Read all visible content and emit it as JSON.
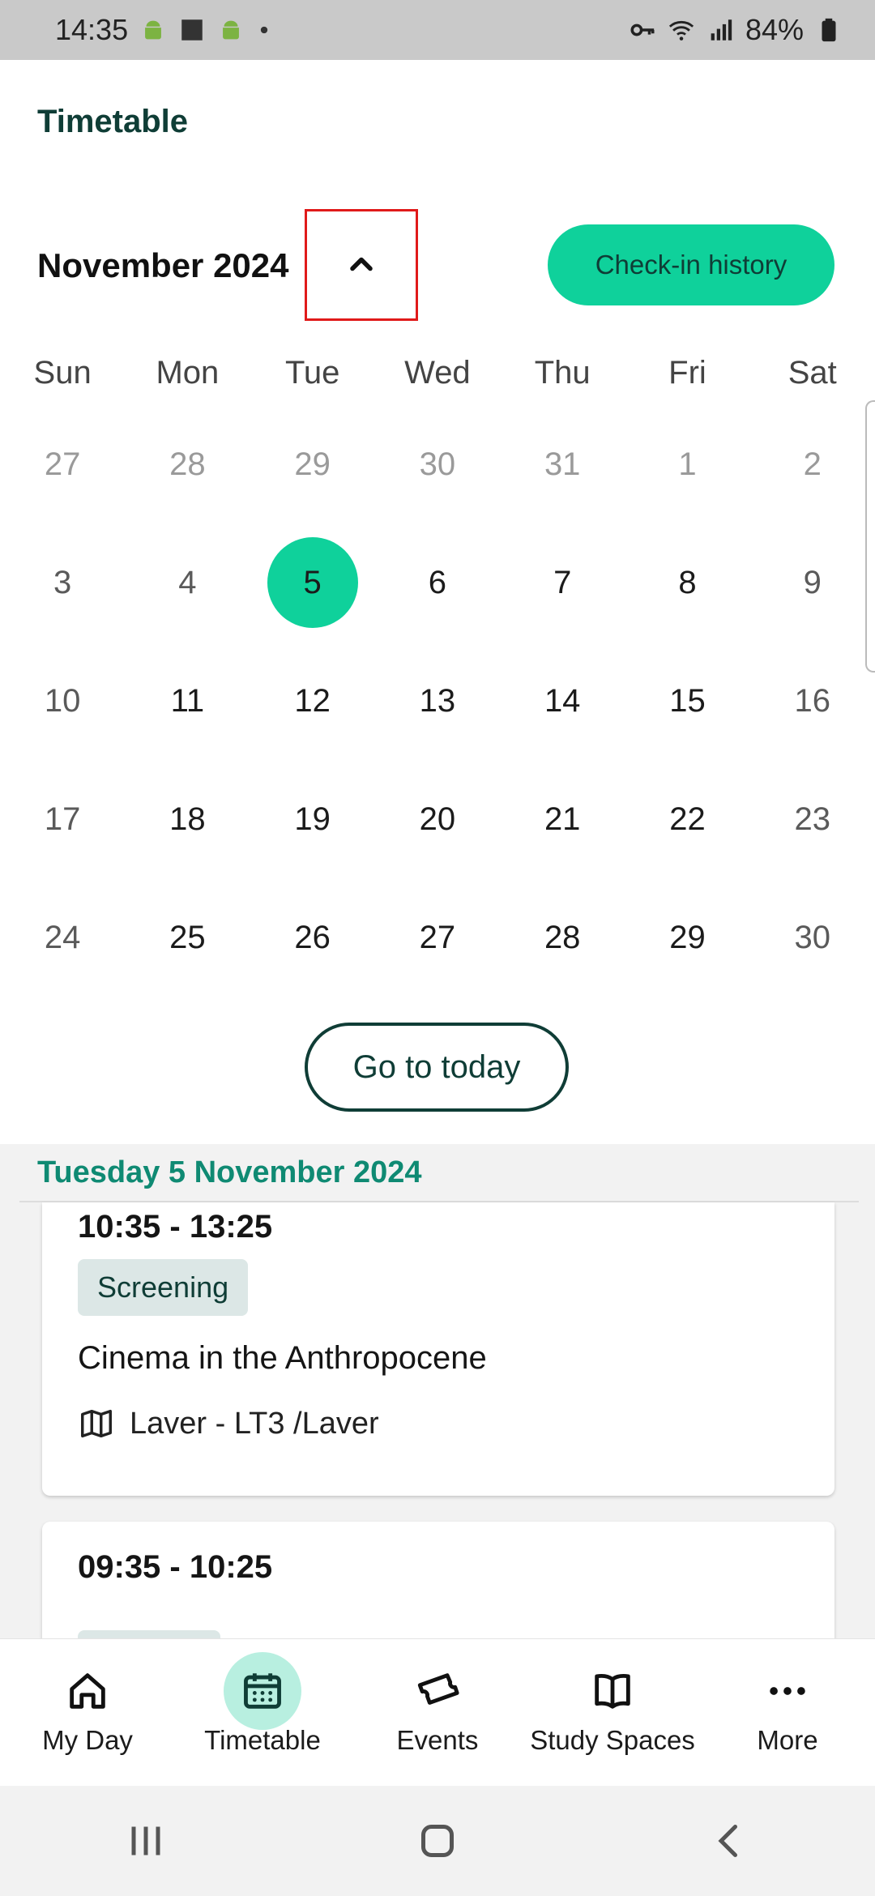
{
  "status_bar": {
    "time": "14:35",
    "battery": "84%"
  },
  "header": {
    "title": "Timetable"
  },
  "calendar": {
    "month": "November 2024",
    "checkin_label": "Check-in history",
    "weekdays": [
      "Sun",
      "Mon",
      "Tue",
      "Wed",
      "Thu",
      "Fri",
      "Sat"
    ],
    "weeks": [
      [
        "27",
        "28",
        "29",
        "30",
        "31",
        "1",
        "2"
      ],
      [
        "3",
        "4",
        "5",
        "6",
        "7",
        "8",
        "9"
      ],
      [
        "10",
        "11",
        "12",
        "13",
        "14",
        "15",
        "16"
      ],
      [
        "17",
        "18",
        "19",
        "20",
        "21",
        "22",
        "23"
      ],
      [
        "24",
        "25",
        "26",
        "27",
        "28",
        "29",
        "30"
      ]
    ],
    "today_label": "Go to today"
  },
  "agenda": {
    "date_header": "Tuesday 5 November 2024",
    "events": [
      {
        "time": "10:35 - 13:25",
        "tag": "Screening",
        "title": "Cinema in the Anthropocene",
        "location": "Laver - LT3 /Laver"
      },
      {
        "time": "09:35 - 10:25"
      }
    ]
  },
  "nav": {
    "items": [
      {
        "label": "My Day",
        "icon": "home-icon"
      },
      {
        "label": "Timetable",
        "icon": "calendar-icon"
      },
      {
        "label": "Events",
        "icon": "ticket-icon"
      },
      {
        "label": "Study Spaces",
        "icon": "book-icon"
      },
      {
        "label": "More",
        "icon": "more-icon"
      }
    ]
  },
  "colors": {
    "accent": "#0fd19b",
    "dark": "#0f3d36",
    "agenda_date": "#0f8a73"
  }
}
